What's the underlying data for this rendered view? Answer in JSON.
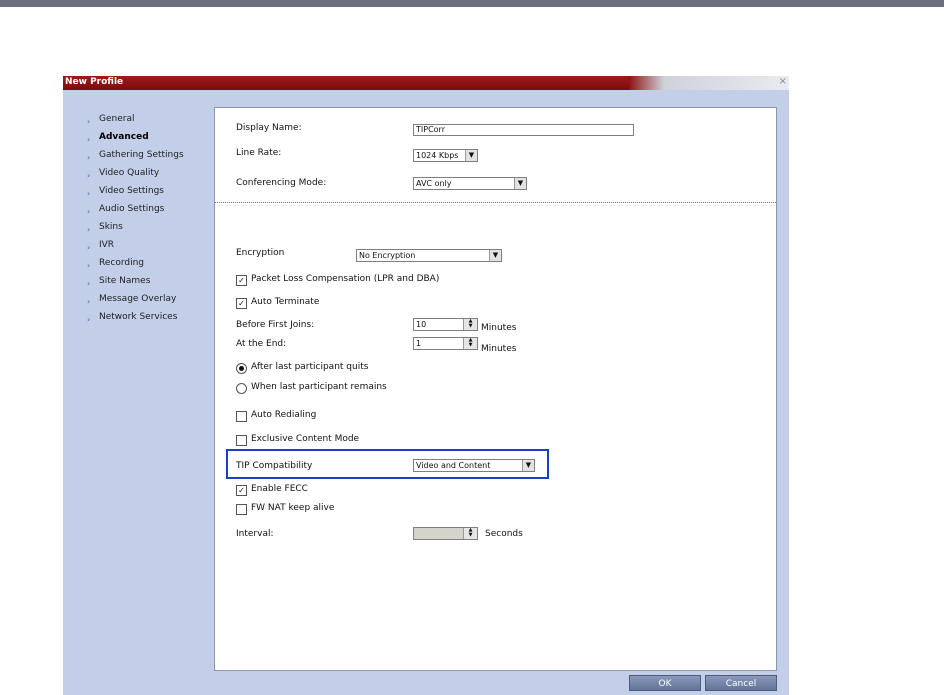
{
  "window": {
    "title": "New Profile",
    "close_glyph": "×"
  },
  "nav": {
    "items": [
      {
        "label": "General",
        "active": false
      },
      {
        "label": "Advanced",
        "active": true
      },
      {
        "label": "Gathering Settings",
        "active": false
      },
      {
        "label": "Video Quality",
        "active": false
      },
      {
        "label": "Video Settings",
        "active": false
      },
      {
        "label": "Audio Settings",
        "active": false
      },
      {
        "label": "Skins",
        "active": false
      },
      {
        "label": "IVR",
        "active": false
      },
      {
        "label": "Recording",
        "active": false
      },
      {
        "label": "Site Names",
        "active": false
      },
      {
        "label": "Message Overlay",
        "active": false
      },
      {
        "label": "Network Services",
        "active": false
      }
    ]
  },
  "form": {
    "display_name": {
      "label": "Display Name:",
      "value": "TIPCorr"
    },
    "line_rate": {
      "label": "Line Rate:",
      "value": "1024 Kbps"
    },
    "conferencing_mode": {
      "label": "Conferencing Mode:",
      "value": "AVC only"
    },
    "encryption": {
      "label": "Encryption",
      "value": "No Encryption"
    },
    "packet_loss": {
      "label": "Packet Loss Compensation (LPR and DBA)",
      "checked": true
    },
    "auto_terminate": {
      "label": "Auto Terminate",
      "checked": true
    },
    "before_first_joins": {
      "label": "Before First Joins:",
      "value": "10",
      "unit": "Minutes"
    },
    "at_the_end": {
      "label": "At the End:",
      "value": "1",
      "unit": "Minutes"
    },
    "after_last_quits": {
      "label": "After last participant quits",
      "selected": true
    },
    "when_last_remains": {
      "label": "When last participant remains",
      "selected": false
    },
    "auto_redialing": {
      "label": "Auto Redialing",
      "checked": false
    },
    "exclusive_content": {
      "label": "Exclusive Content Mode",
      "checked": false
    },
    "tip_compat": {
      "label": "TIP Compatibility",
      "value": "Video and Content"
    },
    "enable_fecc": {
      "label": "Enable FECC",
      "checked": true
    },
    "fw_nat": {
      "label": "FW NAT keep alive",
      "checked": false
    },
    "interval": {
      "label": "Interval:",
      "value": "",
      "unit": "Seconds"
    }
  },
  "buttons": {
    "ok": "OK",
    "cancel": "Cancel"
  },
  "glyphs": {
    "check": "✓",
    "dropdown": "▼",
    "spin_up": "▲",
    "spin_down": "▼",
    "nav_arrow": "›"
  },
  "colors": {
    "title_bar": "#8f1212",
    "highlight_border": "#1a3ec4",
    "sidebar_bg": "#c3cee8",
    "button_bg": "#6d7ca1"
  }
}
